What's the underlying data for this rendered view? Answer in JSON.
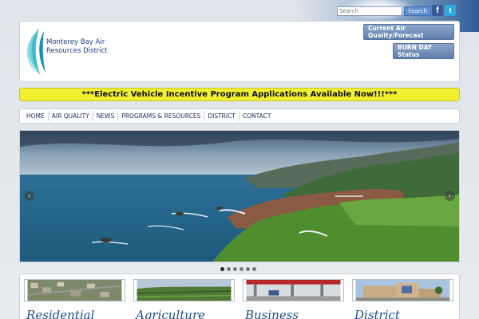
{
  "search": {
    "placeholder": "Search",
    "button_label": "Search"
  },
  "social": {
    "facebook": "f",
    "twitter": "t"
  },
  "header": {
    "org_name_line1": "Monterey Bay Air",
    "org_name_line2": "Resources District",
    "btn_air_quality": "Current Air Quality/Forecast",
    "btn_burn_day": "BURN DAY Status"
  },
  "banner": {
    "text": "***Electric Vehicle Incentive Program Applications Available Now!!!***"
  },
  "nav": {
    "items": [
      "HOME",
      "AIR QUALITY",
      "NEWS",
      "PROGRAMS & RESOURCES",
      "DISTRICT",
      "CONTACT"
    ]
  },
  "slider": {
    "prev": "‹",
    "next": "›",
    "slide_count": 6,
    "active_index": 0
  },
  "cards": [
    {
      "title": "Residential"
    },
    {
      "title": "Agriculture"
    },
    {
      "title": "Business"
    },
    {
      "title": "District"
    }
  ],
  "colors": {
    "brand_blue": "#1e3f84",
    "banner_yellow": "#f0ef30",
    "button_blue": "#5f7fae"
  }
}
